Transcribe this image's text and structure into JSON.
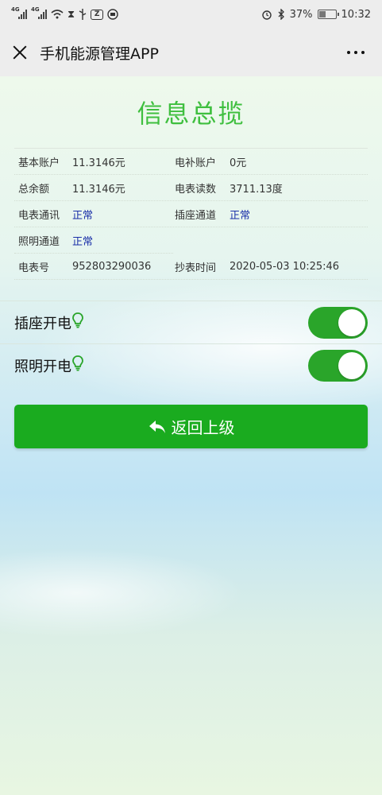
{
  "status_bar": {
    "signal1_label": "4G",
    "signal2_label": "4G",
    "battery_percent": "37%",
    "battery_level": 0.37,
    "time": "10:32"
  },
  "header": {
    "title": "手机能源管理APP"
  },
  "main": {
    "heading": "信息总揽",
    "rows": [
      {
        "label1": "基本账户",
        "value1": "11.3146元",
        "label2": "电补账户",
        "value2": "0元"
      },
      {
        "label1": "总余额",
        "value1": "11.3146元",
        "label2": "电表读数",
        "value2": "3711.13度"
      },
      {
        "label1": "电表通讯",
        "value1": "正常",
        "label2": "插座通道",
        "value2": "正常"
      },
      {
        "label1": "照明通道",
        "value1": "正常"
      },
      {
        "label1": "电表号",
        "value1": "952803290036",
        "label2": "抄表时间",
        "value2": "2020-05-03 10:25:46"
      }
    ],
    "switches": [
      {
        "label": "插座开电",
        "on": true
      },
      {
        "label": "照明开电",
        "on": true
      }
    ],
    "back_label": "返回上级"
  },
  "colors": {
    "accent": "#1aab1f",
    "heading": "#3fbf3f",
    "status_value": "#1a2fa8"
  },
  "icons": [
    "close-icon",
    "more-icon",
    "lightbulb-icon",
    "back-arrow-icon",
    "alarm-icon",
    "bluetooth-icon",
    "battery-icon",
    "wifi-icon",
    "usb-icon"
  ]
}
